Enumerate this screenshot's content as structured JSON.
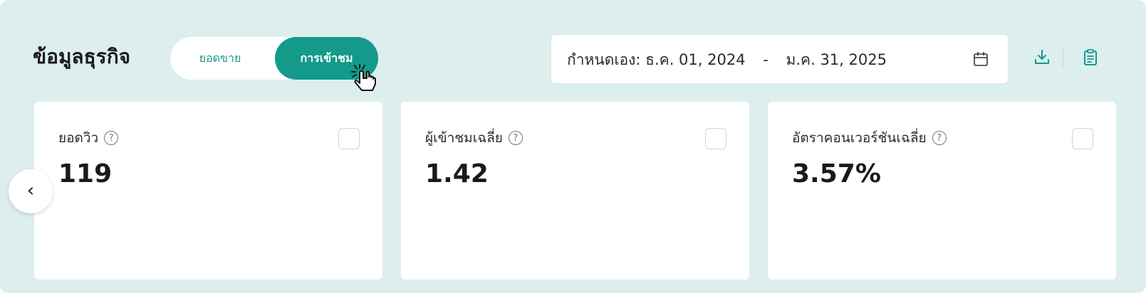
{
  "header": {
    "title": "ข้อมูลธุรกิจ",
    "toggle": {
      "options": [
        "ยอดขาย",
        "การเข้าชม"
      ],
      "selected": "การเข้าชม"
    },
    "date_range": {
      "label": "กำหนดเอง:",
      "start": "ธ.ค. 01, 2024",
      "separator": "-",
      "end": "ม.ค. 31, 2025"
    },
    "icons": {
      "calendar": "calendar-icon",
      "download": "download-icon",
      "report": "clipboard-icon"
    }
  },
  "cards": [
    {
      "label": "ยอดวิว",
      "value": "119"
    },
    {
      "label": "ผู้เข้าชมเฉลี่ย",
      "value": "1.42"
    },
    {
      "label": "อัตราคอนเวอร์ชันเฉลี่ย",
      "value": "3.57%"
    }
  ],
  "nav": {
    "prev": "‹"
  },
  "colors": {
    "accent": "#139a8a",
    "panel_bg": "#dcefee",
    "card_bg": "#ffffff"
  }
}
